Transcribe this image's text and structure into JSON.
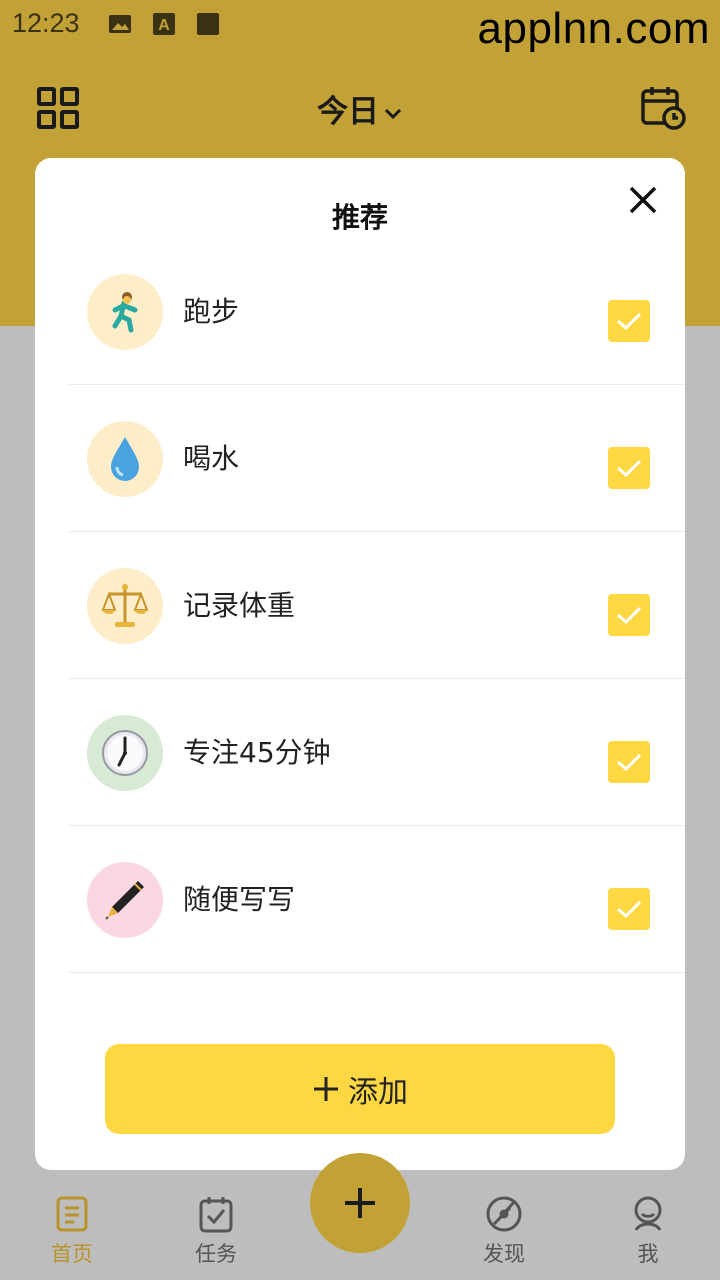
{
  "status_bar": {
    "time": "12:23",
    "watermark": "applnn.com",
    "icons": [
      "image-icon",
      "a-text-icon",
      "square-icon",
      "wifi-icon",
      "battery-icon"
    ]
  },
  "header": {
    "date_label": "今日",
    "icons": [
      "grid-icon",
      "chevron-down-icon",
      "calendar-clock-icon"
    ]
  },
  "modal": {
    "title": "推荐",
    "close_icon": "close-icon",
    "items": [
      {
        "label": "跑步",
        "icon": "runner-icon",
        "icon_bg": "#fdeec9",
        "checked": true
      },
      {
        "label": "喝水",
        "icon": "water-drop-icon",
        "icon_bg": "#fdeec9",
        "checked": true
      },
      {
        "label": "记录体重",
        "icon": "scale-icon",
        "icon_bg": "#fdeec9",
        "checked": true
      },
      {
        "label": "专注45分钟",
        "icon": "clock-icon",
        "icon_bg": "#d6ead4",
        "checked": true
      },
      {
        "label": "随便写写",
        "icon": "pen-icon",
        "icon_bg": "#fbd7e1",
        "checked": true
      }
    ],
    "add_label": "添加"
  },
  "tabbar": {
    "tabs": [
      {
        "label": "首页",
        "icon": "notes-icon",
        "active": true
      },
      {
        "label": "任务",
        "icon": "task-check-icon",
        "active": false
      },
      {
        "label": "发现",
        "icon": "compass-icon",
        "active": false
      },
      {
        "label": "我",
        "icon": "profile-icon",
        "active": false
      }
    ],
    "fab_icon": "plus-icon"
  },
  "colors": {
    "header_bg": "#c2a236",
    "accent": "#fdd843",
    "active_tab": "#b8922a",
    "inactive_tab": "#555555",
    "overlay": "#bdbdbd"
  }
}
